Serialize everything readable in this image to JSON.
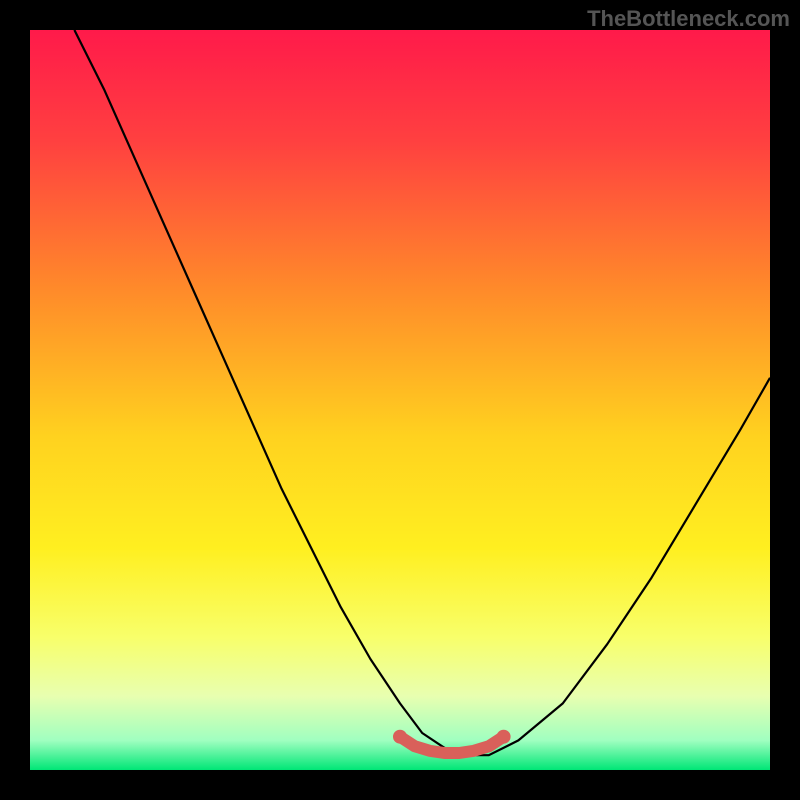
{
  "watermark": "TheBottleneck.com",
  "chart_data": {
    "type": "line",
    "title": "",
    "xlabel": "",
    "ylabel": "",
    "xlim": [
      0,
      100
    ],
    "ylim": [
      0,
      100
    ],
    "gradient_stops": [
      {
        "offset": 0.0,
        "color": "#ff1a4a"
      },
      {
        "offset": 0.15,
        "color": "#ff4040"
      },
      {
        "offset": 0.35,
        "color": "#ff8a2a"
      },
      {
        "offset": 0.55,
        "color": "#ffd21f"
      },
      {
        "offset": 0.7,
        "color": "#ffef20"
      },
      {
        "offset": 0.82,
        "color": "#f8ff6a"
      },
      {
        "offset": 0.9,
        "color": "#e8ffb0"
      },
      {
        "offset": 0.96,
        "color": "#a0ffc0"
      },
      {
        "offset": 1.0,
        "color": "#00e676"
      }
    ],
    "series": [
      {
        "name": "bottleneck-curve",
        "color": "#000000",
        "x": [
          6,
          10,
          14,
          18,
          22,
          26,
          30,
          34,
          38,
          42,
          46,
          50,
          53,
          56,
          59,
          62,
          66,
          72,
          78,
          84,
          90,
          96,
          100
        ],
        "y": [
          100,
          92,
          83,
          74,
          65,
          56,
          47,
          38,
          30,
          22,
          15,
          9,
          5,
          3,
          2,
          2,
          4,
          9,
          17,
          26,
          36,
          46,
          53
        ]
      },
      {
        "name": "optimal-zone-marker",
        "color": "#d9605a",
        "x": [
          50,
          52,
          54,
          56,
          58,
          60,
          62,
          64
        ],
        "y": [
          4.5,
          3.2,
          2.6,
          2.3,
          2.3,
          2.6,
          3.2,
          4.5
        ]
      }
    ]
  }
}
